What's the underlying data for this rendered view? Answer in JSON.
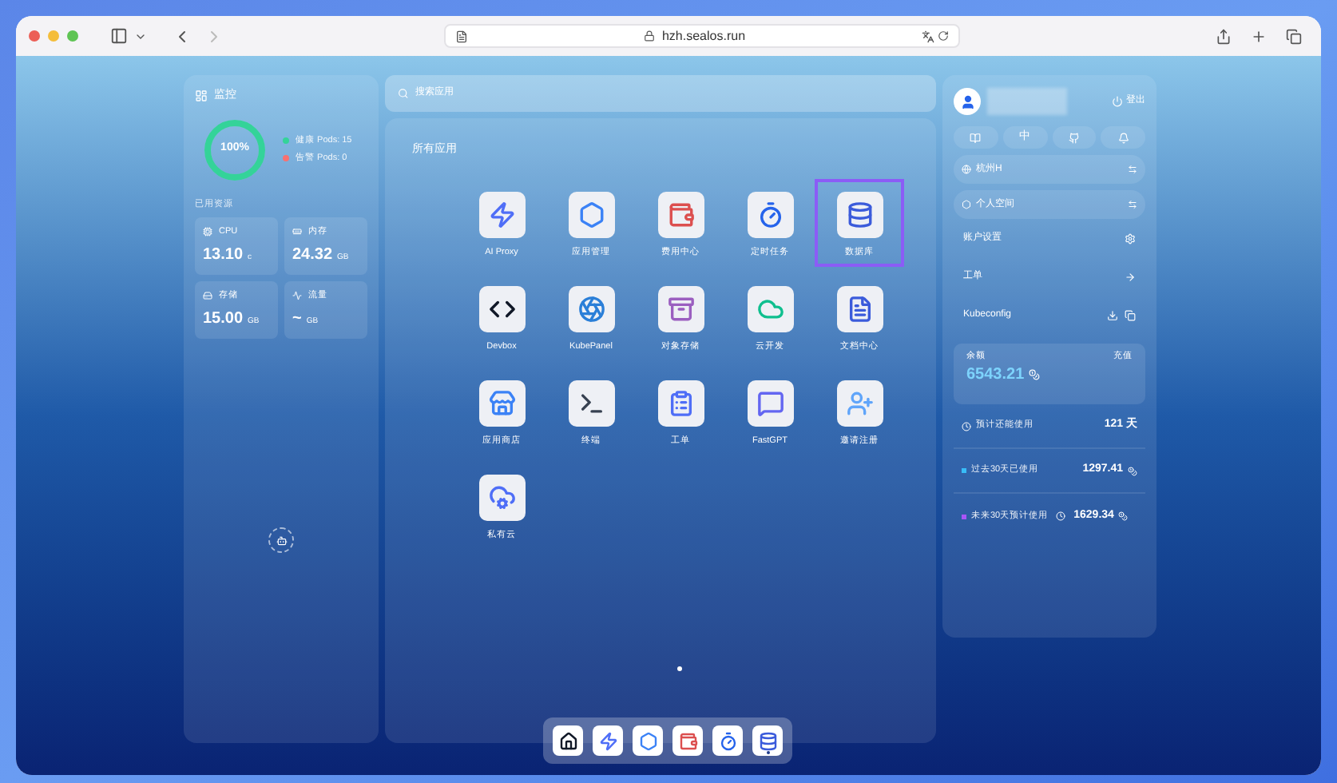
{
  "browser": {
    "address": "hzh.sealos.run"
  },
  "monitor": {
    "title": "监控",
    "ring": {
      "level": 1,
      "reading": "100%"
    },
    "legend": [
      {
        "label": "健康 Pods: 15",
        "color": "#34d399"
      },
      {
        "label": "告警 Pods: 0",
        "color": "#f87171"
      }
    ],
    "resources_title": "已用资源",
    "resources": [
      {
        "label": "CPU",
        "value": "13.10",
        "unit": "c"
      },
      {
        "label": "内存",
        "value": "24.32",
        "unit": "GB"
      },
      {
        "label": "存储",
        "value": "15.00",
        "unit": "GB"
      },
      {
        "label": "流量",
        "value": "~",
        "unit": "GB"
      }
    ]
  },
  "search": {
    "placeholder": "搜索应用"
  },
  "apps": {
    "title": "所有应用",
    "items": [
      {
        "label": "AI Proxy",
        "selected": false
      },
      {
        "label": "应用管理",
        "selected": false
      },
      {
        "label": "费用中心",
        "selected": false
      },
      {
        "label": "定时任务",
        "selected": false
      },
      {
        "label": "数据库",
        "selected": true
      },
      {
        "label": "Devbox",
        "selected": false
      },
      {
        "label": "KubePanel",
        "selected": false
      },
      {
        "label": "对象存储",
        "selected": false
      },
      {
        "label": "云开发",
        "selected": false
      },
      {
        "label": "文档中心",
        "selected": false
      },
      {
        "label": "应用商店",
        "selected": false
      },
      {
        "label": "终端",
        "selected": false
      },
      {
        "label": "工单",
        "selected": false
      },
      {
        "label": "FastGPT",
        "selected": false
      },
      {
        "label": "邀请注册",
        "selected": false
      },
      {
        "label": "私有云",
        "selected": false
      }
    ]
  },
  "dock": [
    {
      "running": false
    },
    {
      "running": false
    },
    {
      "running": false
    },
    {
      "running": false
    },
    {
      "running": false
    },
    {
      "running": true
    }
  ],
  "account": {
    "logout": "登出",
    "language": "中",
    "workspaces": [
      {
        "label": "杭州H"
      },
      {
        "label": "个人空间"
      }
    ],
    "links": [
      {
        "label": "账户设置",
        "kind": "settings"
      },
      {
        "label": "工单",
        "kind": "arrow"
      },
      {
        "label": "Kubeconfig",
        "kind": "kubeconfig"
      }
    ],
    "balance": {
      "label": "余额",
      "value": "6543.21",
      "action": "充值"
    },
    "stats": [
      {
        "label": "预计还能使用",
        "value": "121 天",
        "kind": "clock"
      },
      {
        "label": "过去30天已使用",
        "value": "1297.41",
        "kind": "dot",
        "color": "#38bdf8"
      },
      {
        "label": "未来30天预计使用",
        "value": "1629.34",
        "kind": "dot-clock",
        "color": "#a855f7"
      }
    ]
  }
}
